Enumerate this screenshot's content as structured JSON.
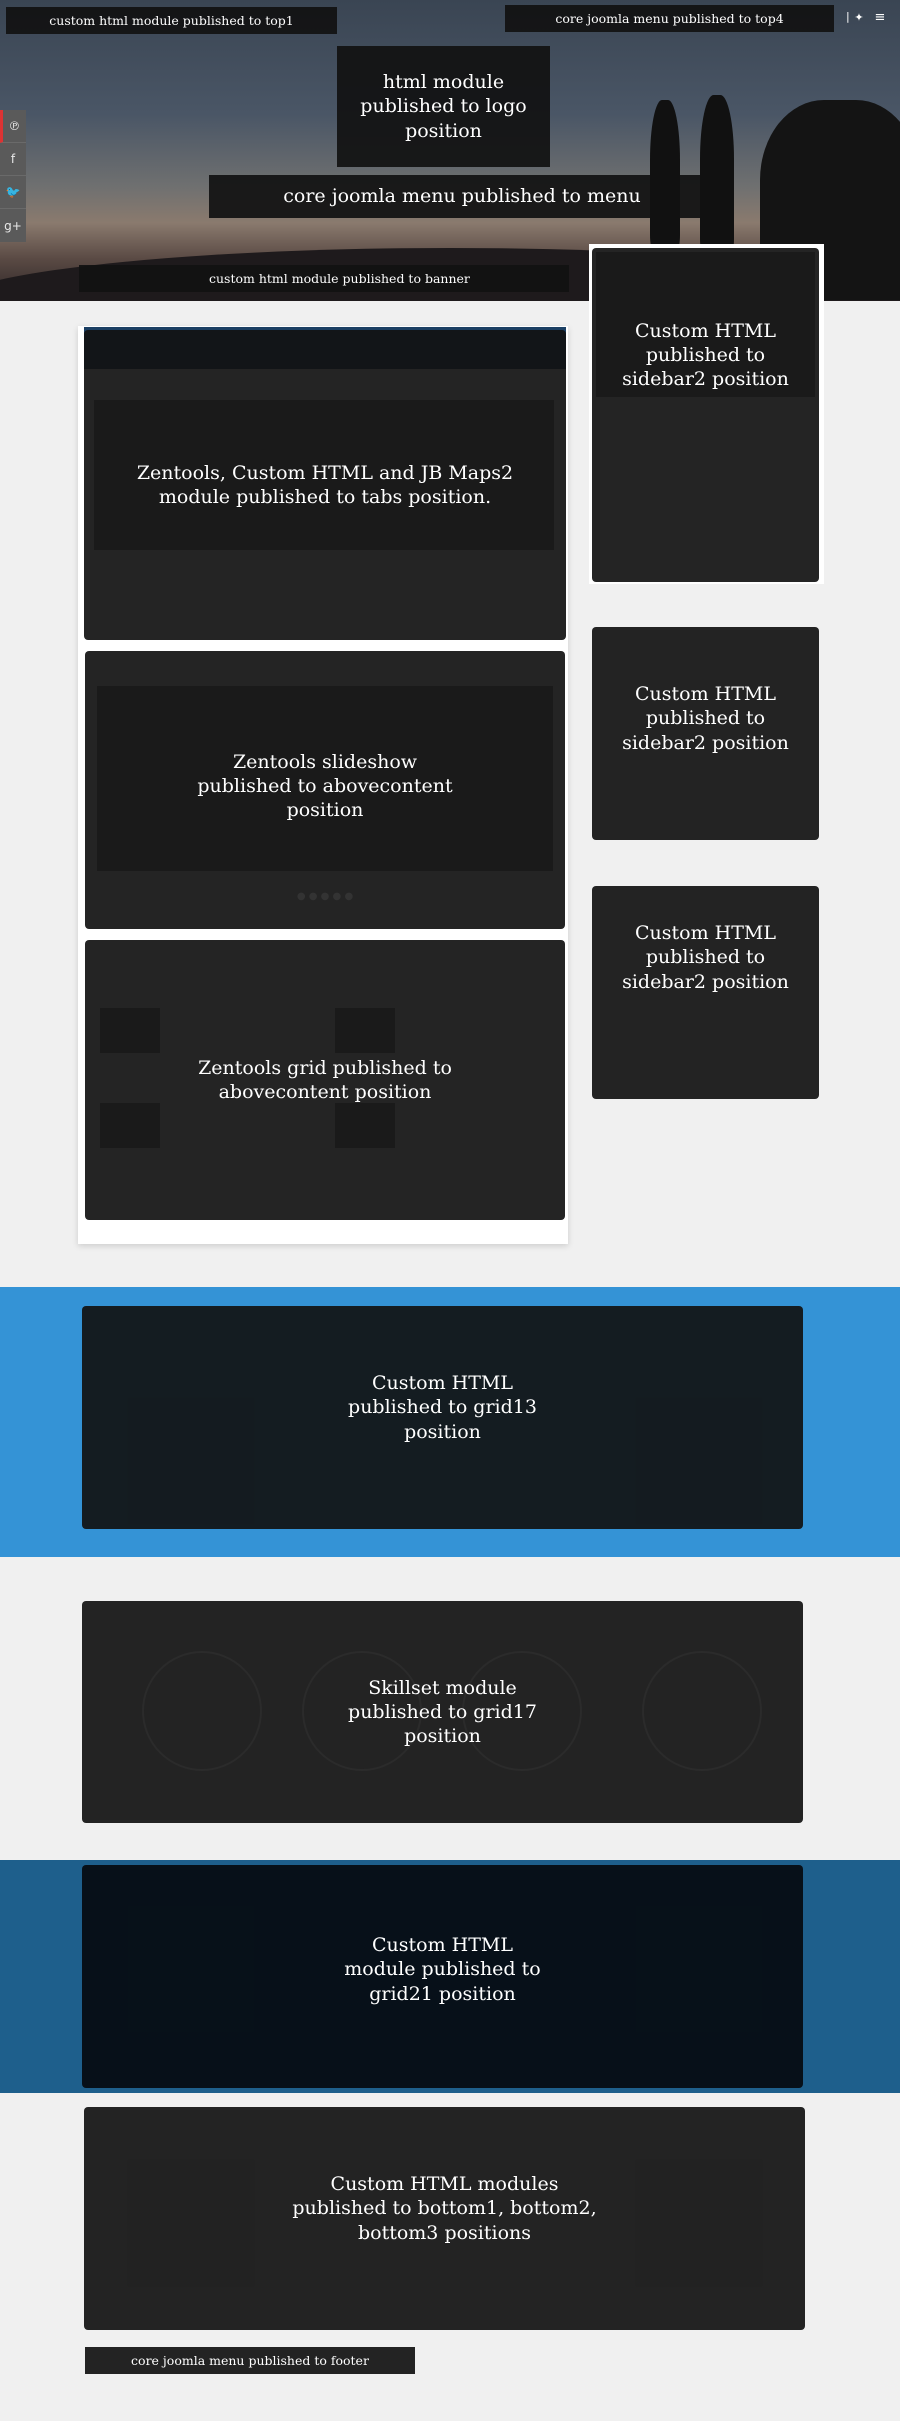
{
  "top": {
    "top1_label": "custom html module published to top1",
    "top4_label": "core joomla menu published to top4",
    "menu_icon": "hamburger-icon",
    "extra_icon": "plus-icon"
  },
  "social": {
    "items": [
      {
        "icon": "pinterest-icon",
        "glyph": "℗"
      },
      {
        "icon": "facebook-icon",
        "glyph": "f"
      },
      {
        "icon": "twitter-icon",
        "glyph": "🐦"
      },
      {
        "icon": "google-plus-icon",
        "glyph": "g+"
      }
    ]
  },
  "logo": {
    "label": "html module published to logo position"
  },
  "menu": {
    "label": "core joomla menu published to menu"
  },
  "banner": {
    "label": "custom html module published to banner"
  },
  "tabs": {
    "label": "Zentools, Custom HTML and JB Maps2 module published to tabs position."
  },
  "slideshow": {
    "label": "Zentools slideshow published to abovecontent position"
  },
  "grid": {
    "label": "Zentools grid published to abovecontent position"
  },
  "sidebar": {
    "label1": "Custom HTML published to sidebar2 position",
    "label2": "Custom HTML published to sidebar2 position",
    "label3": "Custom HTML published to sidebar2 position"
  },
  "grid13": {
    "label": "Custom HTML published to grid13 position"
  },
  "grid17": {
    "label": "Skillset module published to grid17 position"
  },
  "grid21": {
    "label": "Custom HTML module published to grid21 position"
  },
  "bottom": {
    "label": "Custom HTML modules published to bottom1, bottom2, bottom3 positions"
  },
  "footer": {
    "label": "core joomla menu published to footer"
  },
  "colors": {
    "accent_blue": "#3493d6",
    "dark_blue": "#1e5f8c",
    "overlay": "#111111"
  }
}
